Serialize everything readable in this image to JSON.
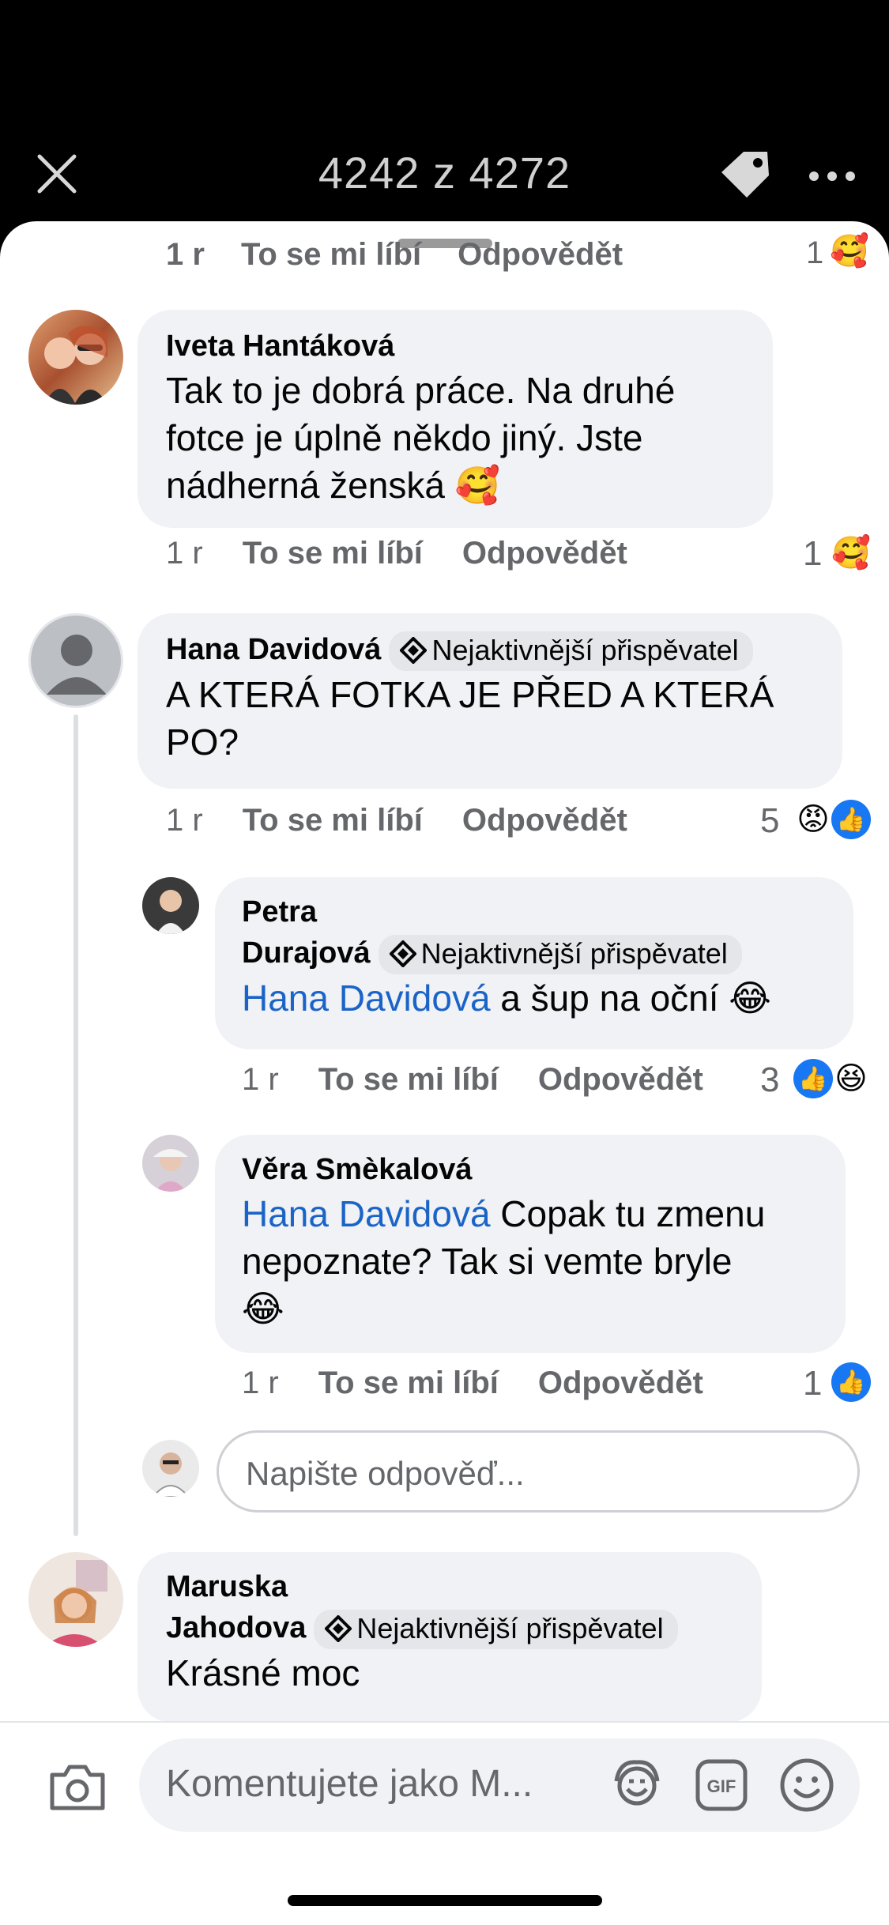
{
  "header": {
    "counter": "4242 z 4272"
  },
  "previous_comment": {
    "time": "1 r",
    "like": "To se mi líbí",
    "reply": "Odpovědět",
    "count": "1",
    "emoji": "🥰"
  },
  "comments": [
    {
      "author": "Iveta Hantáková",
      "text": "Tak to je dobrá práce.  Na druhé fotce je úplně někdo jiný.  Jste nádherná ženská  🥰",
      "time": "1 r",
      "like": "To se mi líbí",
      "reply": "Odpovědět",
      "reaction_count": "1",
      "reactions": [
        "🥰"
      ]
    },
    {
      "author": "Hana Davidová",
      "badge": "Nejaktivnější přispěvatel",
      "text": "A KTERÁ FOTKA JE PŘED A KTERÁ PO?",
      "time": "1 r",
      "like": "To se mi líbí",
      "reply": "Odpovědět",
      "reaction_count": "5",
      "reactions": [
        "😡",
        "👍"
      ]
    }
  ],
  "replies": [
    {
      "author_line1": "Petra",
      "author_line2": "Durajová",
      "badge": "Nejaktivnější přispěvatel",
      "mention": "Hana Davidová",
      "text": " a šup na oční 😂",
      "time": "1 r",
      "like": "To se mi líbí",
      "reply": "Odpovědět",
      "reaction_count": "3",
      "reactions": [
        "👍",
        "😆"
      ]
    },
    {
      "author": "Věra Smèkalová",
      "mention": "Hana Davidová",
      "text_line1": " Copak tu zmenu",
      "text_line2": "nepoznate? Tak si vemte bryle",
      "text_line3": "😂",
      "time": "1 r",
      "like": "To se mi líbí",
      "reply": "Odpovědět",
      "reaction_count": "1",
      "reactions": [
        "👍"
      ]
    }
  ],
  "reply_input": {
    "placeholder": "Napište odpověď..."
  },
  "last_comment": {
    "author_line1": "Maruska",
    "author_line2": "Jahodova",
    "badge": "Nejaktivnější přispěvatel",
    "text": "Krásné moc"
  },
  "composer": {
    "placeholder": "Komentujete jako M..."
  },
  "colors": {
    "mention": "#1b64c7",
    "like_blue": "#1877f2",
    "bubble": "#f0f2f5",
    "meta": "#65676b"
  }
}
